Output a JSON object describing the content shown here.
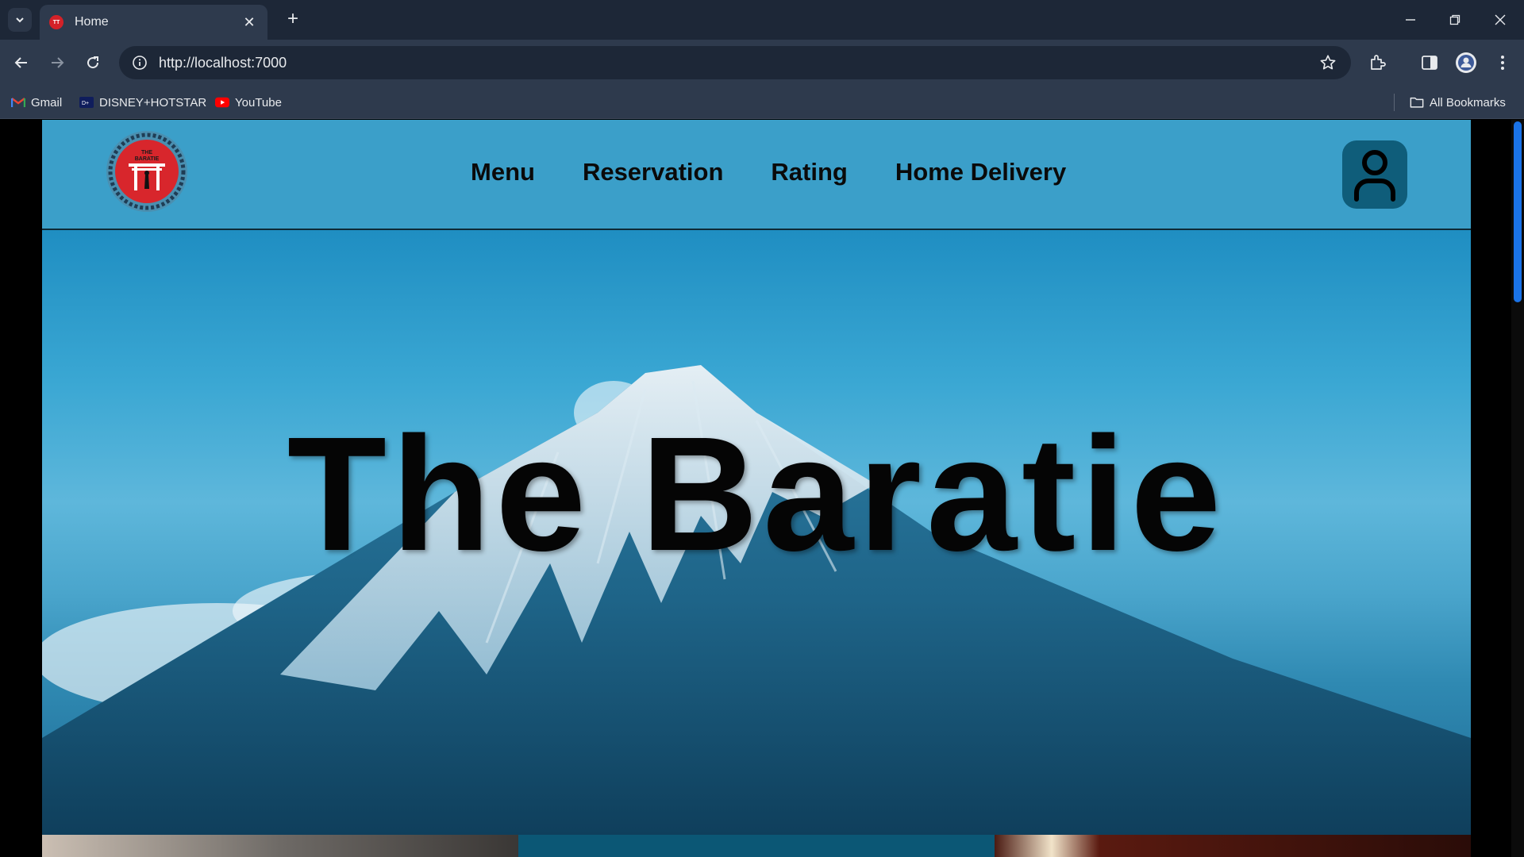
{
  "browser": {
    "tab_title": "Home",
    "tab_favicon_text": "TT",
    "url": "http://localhost:7000",
    "bookmarks": [
      {
        "label": "Gmail",
        "icon": "gmail-icon"
      },
      {
        "label": "DISNEY+HOTSTAR",
        "icon": "hotstar-icon"
      },
      {
        "label": "YouTube",
        "icon": "youtube-icon"
      }
    ],
    "all_bookmarks": "All Bookmarks"
  },
  "site": {
    "nav": [
      "Menu",
      "Reservation",
      "Rating",
      "Home Delivery"
    ],
    "hero_title": "The Baratie",
    "logo_text": "THE BARATIE"
  },
  "colors": {
    "header_bg": "#3b9fc9",
    "profile_bg": "#0f5d7a",
    "chrome_dark": "#1d2737",
    "chrome": "#2e3a4d",
    "scroll_thumb": "#1a73e8"
  }
}
